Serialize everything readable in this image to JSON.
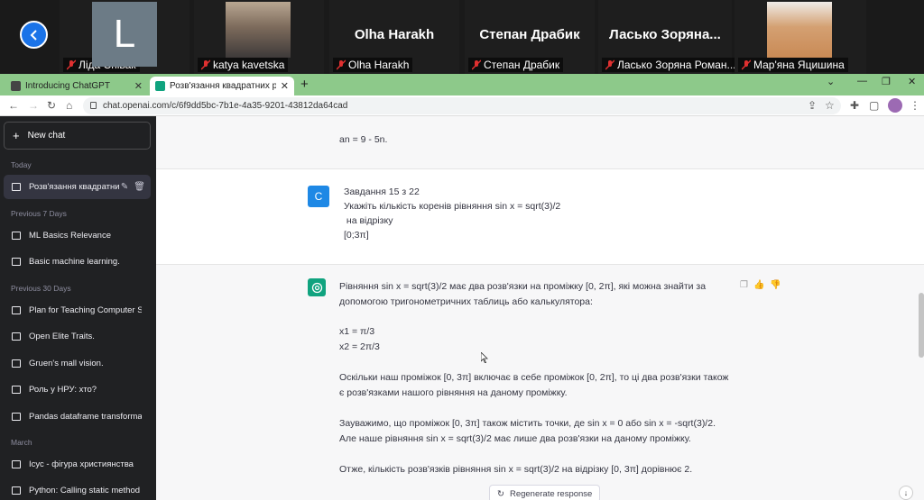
{
  "zoom": {
    "participants": [
      {
        "label": "Ліда Співак",
        "initial": "L"
      },
      {
        "label": "katya kavetska"
      },
      {
        "label": "Olha Harakh",
        "display": "Olha Harakh"
      },
      {
        "label": "Степан Драбик",
        "display": "Степан Драбик"
      },
      {
        "label": "Ласько Зоряна Роман...",
        "display": "Ласько Зоряна..."
      },
      {
        "label": "Мар'яна Яцишина"
      }
    ]
  },
  "browser": {
    "tabs": [
      {
        "title": "Introducing ChatGPT"
      },
      {
        "title": "Розв'язання квадратних рівнянь"
      }
    ],
    "url": "chat.openai.com/c/6f9dd5bc-7b1e-4a35-9201-43812da64cad"
  },
  "sidebar": {
    "new_chat": "New chat",
    "sections": [
      {
        "label": "Today",
        "items": [
          "Розв'язання квадратних"
        ]
      },
      {
        "label": "Previous 7 Days",
        "items": [
          "ML Basics Relevance",
          "Basic machine learning."
        ]
      },
      {
        "label": "Previous 30 Days",
        "items": [
          "Plan for Teaching Computer Sc",
          "Open Elite Traits.",
          "Gruen's mall vision.",
          "Роль у НРУ: хто?",
          "Pandas dataframe transformat"
        ]
      },
      {
        "label": "March",
        "items": [
          "Ісус - фігура християнства",
          "Python: Calling static method"
        ]
      }
    ]
  },
  "conversation": {
    "prev_tail": "an = 9 - 5n.",
    "user": {
      "avatar": "C",
      "lines": [
        "Завдання 15 з 22",
        "Укажіть кількість коренів рівняння  sin x = sqrt(3)/2",
        " на відрізку",
        "[0;3π]"
      ]
    },
    "assistant": {
      "p1": [
        "Рівняння sin x = sqrt(3)/2 має два розв'язки на проміжку [0, 2π], які можна знайти за",
        "допомогою тригонометричних таблиць або калькулятора:"
      ],
      "p2": [
        "x1 = π/3",
        "x2 = 2π/3"
      ],
      "p3": [
        "Оскільки наш проміжок [0, 3π] включає в себе проміжок [0, 2π], то ці два розв'язки також",
        "є розв'язками нашого рівняння на даному проміжку."
      ],
      "p4": [
        "Зауважимо, що проміжок [0, 3π] також містить точки, де sin x = 0 або sin x = -sqrt(3)/2.",
        "Але наше рівняння sin x = sqrt(3)/2 має лише два розв'язки на даному проміжку."
      ],
      "p5": [
        "Отже, кількість розв'язків рівняння sin x = sqrt(3)/2 на відрізку [0, 3π] дорівнює 2."
      ]
    },
    "regenerate": "Regenerate response"
  }
}
